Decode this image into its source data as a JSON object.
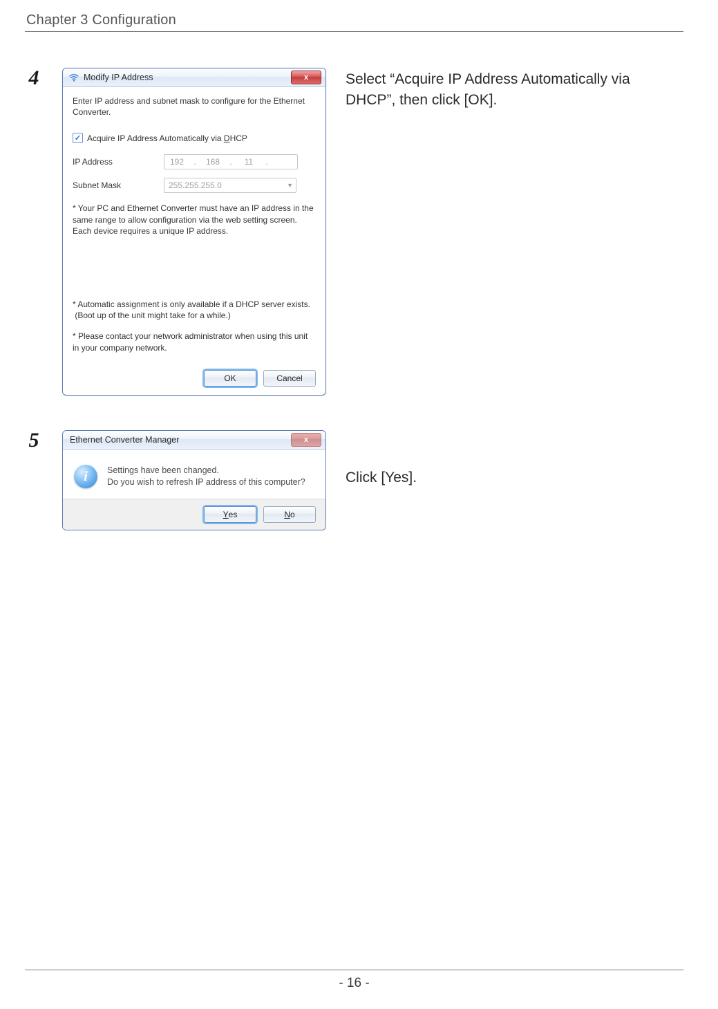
{
  "header": {
    "chapter": "Chapter 3  Configuration"
  },
  "footer": {
    "page_label": "- 16 -"
  },
  "step4": {
    "number": "4",
    "instruction": "Select “Acquire IP Address Automatically via DHCP”, then click [OK].",
    "dialog": {
      "title": "Modify IP Address",
      "close": "x",
      "intro": "Enter IP address and subnet mask to configure for the Ethernet Converter.",
      "checkbox_checked": "✓",
      "checkbox_label_pre": "Acquire IP Address Automatically via ",
      "checkbox_label_accel": "D",
      "checkbox_label_post": "HCP",
      "ip_label": "IP Address",
      "ip": {
        "o1": "192",
        "o2": "168",
        "o3": "11",
        "o4": "",
        "dot": "."
      },
      "subnet_label": "Subnet Mask",
      "subnet_value": "255.255.255.0",
      "note1": "* Your PC and Ethernet Converter must have an IP address in the same range to allow configuration via the web setting screen. Each device requires a unique IP address.",
      "note2a": "* Automatic assignment is only available if a DHCP server exists.",
      "note2b": " (Boot up of the unit might take for a while.)",
      "note3": "* Please contact your network administrator when using this unit in your company network.",
      "ok": "OK",
      "cancel": "Cancel"
    }
  },
  "step5": {
    "number": "5",
    "instruction": "Click [Yes].",
    "dialog": {
      "title": "Ethernet Converter Manager",
      "close": "x",
      "line1": "Settings have been changed.",
      "line2": "Do you wish to refresh IP address of this computer?",
      "yes_accel": "Y",
      "yes_post": "es",
      "no_accel": "N",
      "no_post": "o"
    }
  }
}
